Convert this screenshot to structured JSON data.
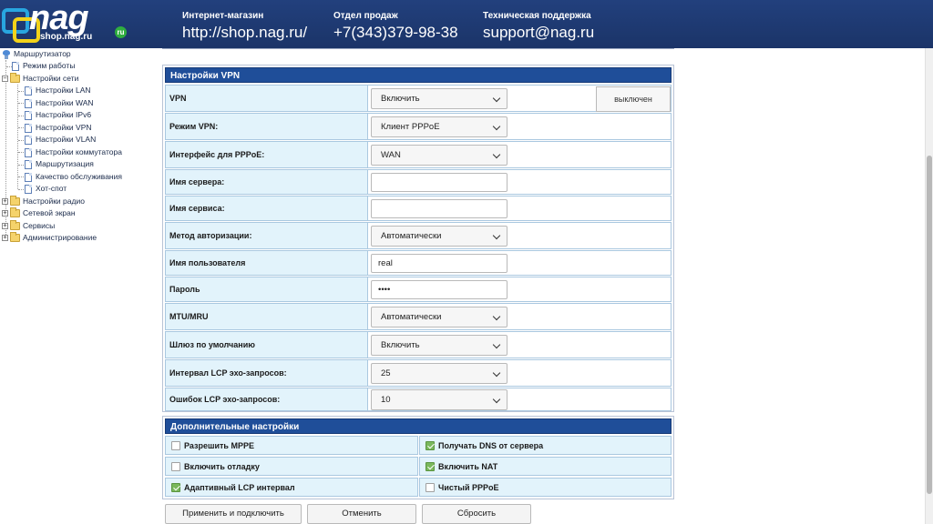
{
  "header": {
    "logo_word": "nag",
    "logo_sub": "shop.nag.ru",
    "logo_badge": "ru",
    "cols": [
      {
        "caption": "Интернет-магазин",
        "value": "http://shop.nag.ru/"
      },
      {
        "caption": "Отдел продаж",
        "value": "+7(343)379-98-38"
      },
      {
        "caption": "Техническая поддержка",
        "value": "support@nag.ru"
      }
    ]
  },
  "tree": {
    "root": "Маршрутизатор",
    "work_mode": "Режим работы",
    "net_settings": "Настройки сети",
    "net_children": [
      "Настройки LAN",
      "Настройки WAN",
      "Настройки IPv6",
      "Настройки VPN",
      "Настройки VLAN",
      "Настройки коммутатора",
      "Маршрутизация",
      "Качество обслуживания",
      "Хот-спот"
    ],
    "others": [
      "Настройки радио",
      "Сетевой экран",
      "Сервисы",
      "Администрирование"
    ],
    "expand_glyph": "+",
    "collapse_glyph": "−"
  },
  "vpn": {
    "title": "Настройки VPN",
    "status": "выключен",
    "rows": [
      {
        "label": "VPN",
        "type": "select",
        "value": "Включить"
      },
      {
        "label": "Режим VPN:",
        "type": "select",
        "value": "Клиент PPPoE"
      },
      {
        "label": "Интерфейс для PPPoE:",
        "type": "select",
        "value": "WAN"
      },
      {
        "label": "Имя сервера:",
        "type": "input",
        "value": ""
      },
      {
        "label": "Имя сервиса:",
        "type": "input",
        "value": ""
      },
      {
        "label": "Метод авторизации:",
        "type": "select",
        "value": "Автоматически"
      },
      {
        "label": "Имя пользователя",
        "type": "input",
        "value": "real"
      },
      {
        "label": "Пароль",
        "type": "input",
        "value": "••••"
      },
      {
        "label": "MTU/MRU",
        "type": "select",
        "value": "Автоматически"
      },
      {
        "label": "Шлюз по умолчанию",
        "type": "select",
        "value": "Включить"
      },
      {
        "label": "Интервал LCP эхо-запросов:",
        "type": "select",
        "value": "25"
      },
      {
        "label": "Ошибок LCP эхо-запросов:",
        "type": "select",
        "value": "10"
      }
    ]
  },
  "extra": {
    "title": "Дополнительные настройки",
    "options": [
      {
        "label": "Разрешить MPPE",
        "checked": false
      },
      {
        "label": "Получать DNS от сервера",
        "checked": true
      },
      {
        "label": "Включить отладку",
        "checked": false
      },
      {
        "label": "Включить NAT",
        "checked": true
      },
      {
        "label": "Адаптивный LCP интервал",
        "checked": true
      },
      {
        "label": "Чистый PPPoE",
        "checked": false
      }
    ]
  },
  "buttons": {
    "apply": "Применить и подключить",
    "cancel": "Отменить",
    "reset": "Сбросить"
  }
}
